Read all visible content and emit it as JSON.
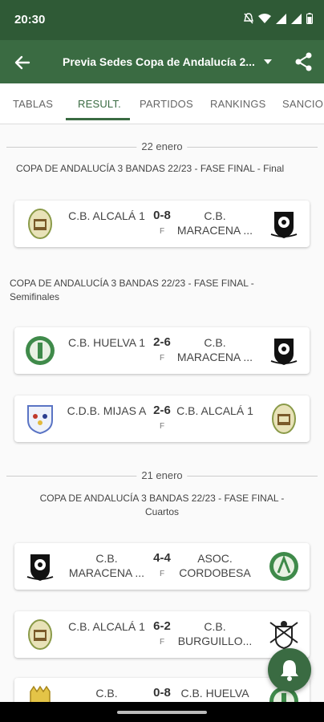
{
  "status_bar": {
    "time": "20:30"
  },
  "app_bar": {
    "title": "Previa Sedes Copa de Andalucía 2..."
  },
  "tabs": [
    "TABLAS",
    "RESULT.",
    "PARTIDOS",
    "RANKINGS",
    "SANCIONES"
  ],
  "sections": [
    {
      "date": "22 enero",
      "groups": [
        {
          "competition": "COPA DE ANDALUCÍA 3 BANDAS 22/23 - FASE FINAL - Final",
          "matches": [
            {
              "home": "C.B. ALCALÁ 1",
              "away": "C.B. MARACENA ...",
              "score": "0-8",
              "status": "F"
            }
          ]
        },
        {
          "competition": "COPA DE ANDALUCÍA 3 BANDAS 22/23 - FASE FINAL - Semifinales",
          "matches": [
            {
              "home": "C.B. HUELVA 1",
              "away": "C.B. MARACENA ...",
              "score": "2-6",
              "status": "F"
            },
            {
              "home": "C.D.B. MIJAS A",
              "away": "C.B. ALCALÁ 1",
              "score": "2-6",
              "status": "F"
            }
          ]
        }
      ]
    },
    {
      "date": "21 enero",
      "groups": [
        {
          "competition": "COPA DE ANDALUCÍA 3 BANDAS 22/23 - FASE FINAL - Cuartos",
          "matches": [
            {
              "home": "C.B. MARACENA ...",
              "away": "ASOC. CORDOBESA",
              "score": "4-4",
              "status": "F"
            },
            {
              "home": "C.B. ALCALÁ 1",
              "away": "C.B. BURGUILLO...",
              "score": "6-2",
              "status": "F"
            },
            {
              "home": "C.B.",
              "away": "C.B. HUELVA",
              "score": "0-8",
              "status": ""
            }
          ]
        }
      ]
    }
  ],
  "colors": {
    "primary": "#3a6b42",
    "status_bar": "#2f5a36"
  },
  "icons": [
    "back-arrow-icon",
    "dropdown-arrow-icon",
    "share-icon",
    "bell-icon"
  ]
}
